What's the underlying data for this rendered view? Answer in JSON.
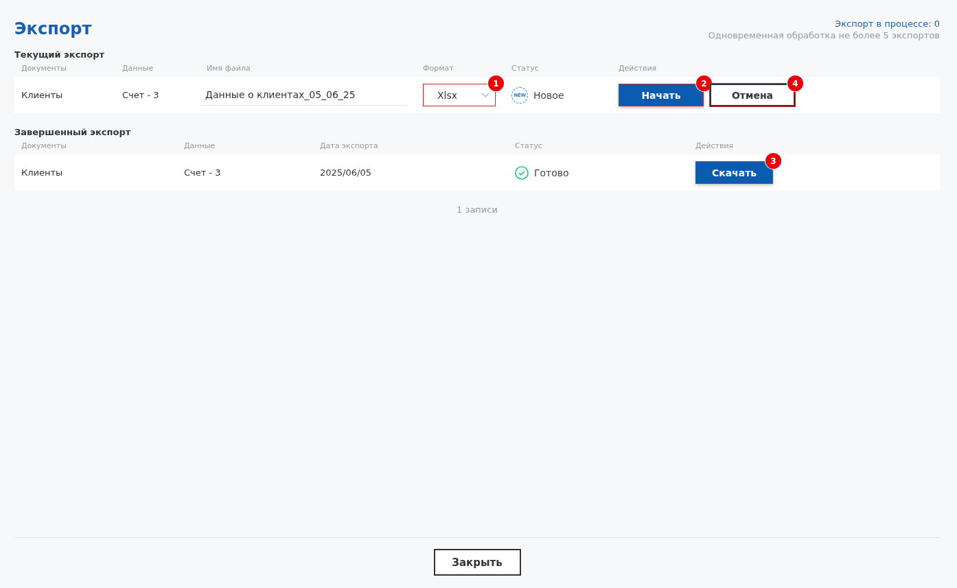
{
  "title": "Экспорт",
  "info": {
    "in_progress": "Экспорт в процессе: 0",
    "limit": "Одновременная обработка не более 5 экспортов"
  },
  "current": {
    "heading": "Текущий экспорт",
    "columns": [
      "Документы",
      "Данные",
      "Имя файла",
      "Формат",
      "Статус",
      "Действия"
    ],
    "row": {
      "documents": "Клиенты",
      "data": "Счет - 3",
      "filename": "Данные о клиентах_05_06_25",
      "format": "Xlsx",
      "format_callout": "1",
      "status": {
        "text": "Новое",
        "kind": "new",
        "icon_text": "NEW"
      },
      "actions": [
        {
          "label": "Начать",
          "kind": "primary",
          "callout": "2"
        },
        {
          "label": "Отмена",
          "kind": "outline",
          "callout": "4"
        }
      ]
    }
  },
  "completed": {
    "heading": "Завершенный экспорт",
    "columns": [
      "Документы",
      "Данные",
      "Дата экспорта",
      "Статус",
      "Действия"
    ],
    "rows": [
      {
        "documents": "Клиенты",
        "data": "Счет - 3",
        "date": "2025/06/05",
        "status": {
          "text": "Готово",
          "kind": "done"
        },
        "actions": [
          {
            "label": "Скачать",
            "kind": "primary",
            "callout": "3"
          }
        ]
      }
    ],
    "count": "1 записи"
  },
  "footer": {
    "close": "Закрыть"
  }
}
